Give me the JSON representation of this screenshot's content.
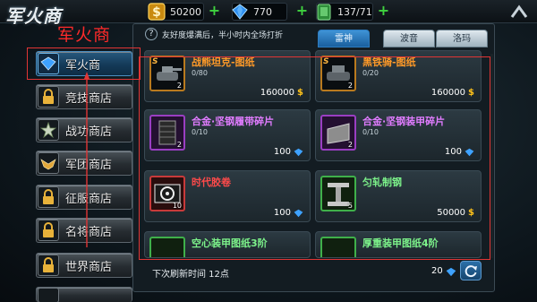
{
  "header": {
    "title": "军火商",
    "coins": "50200",
    "diamonds": "770",
    "energy": "137/71",
    "plus_label": "+"
  },
  "annotation": {
    "label": "军火商"
  },
  "sidebar": {
    "items": [
      {
        "label": "军火商",
        "icon": "diamond-icon"
      },
      {
        "label": "竞技商店",
        "icon": "lock-icon"
      },
      {
        "label": "战功商店",
        "icon": "medal-icon"
      },
      {
        "label": "军团商店",
        "icon": "eagle-icon"
      },
      {
        "label": "征服商店",
        "icon": "lock-icon"
      },
      {
        "label": "名将商店",
        "icon": "lock-icon"
      },
      {
        "label": "世界商店",
        "icon": "lock-icon"
      }
    ]
  },
  "panel": {
    "info_icon": "?",
    "info_text": "友好度爆满后，半小时内全场打折",
    "tabs": [
      "雷神",
      "波音",
      "洛玛"
    ],
    "items": [
      {
        "name": "战熊坦克-图纸",
        "progress": "0/80",
        "qty": "2",
        "price": "160000",
        "currency": "coin",
        "tier": "S"
      },
      {
        "name": "黑铁骑-图纸",
        "progress": "0/20",
        "qty": "2",
        "price": "160000",
        "currency": "coin",
        "tier": "S"
      },
      {
        "name": "合金·坚钢履带碎片",
        "progress": "0/10",
        "qty": "2",
        "price": "100",
        "currency": "diamond"
      },
      {
        "name": "合金·坚钢装甲碎片",
        "progress": "0/10",
        "qty": "2",
        "price": "100",
        "currency": "diamond"
      },
      {
        "name": "时代胶卷",
        "progress": "",
        "qty": "10",
        "price": "100",
        "currency": "diamond"
      },
      {
        "name": "匀轧制钢",
        "progress": "",
        "qty": "5",
        "price": "50000",
        "currency": "coin"
      },
      {
        "name": "空心装甲图纸3阶",
        "progress": "",
        "qty": "",
        "price": "",
        "currency": ""
      },
      {
        "name": "厚重装甲图纸4阶",
        "progress": "",
        "qty": "",
        "price": "",
        "currency": ""
      }
    ],
    "refresh_text": "下次刷新时间  12点",
    "refresh_cost": "20"
  },
  "colors": {
    "accent": "#2d7cc0",
    "annotation_red": "#e03535",
    "name_orange": "#ff9a28",
    "name_purple": "#e07cff",
    "name_red": "#ff4a4a",
    "name_green": "#7cf28a",
    "coin_gold": "#ffc21a",
    "diamond_blue": "#3ea2ff"
  }
}
